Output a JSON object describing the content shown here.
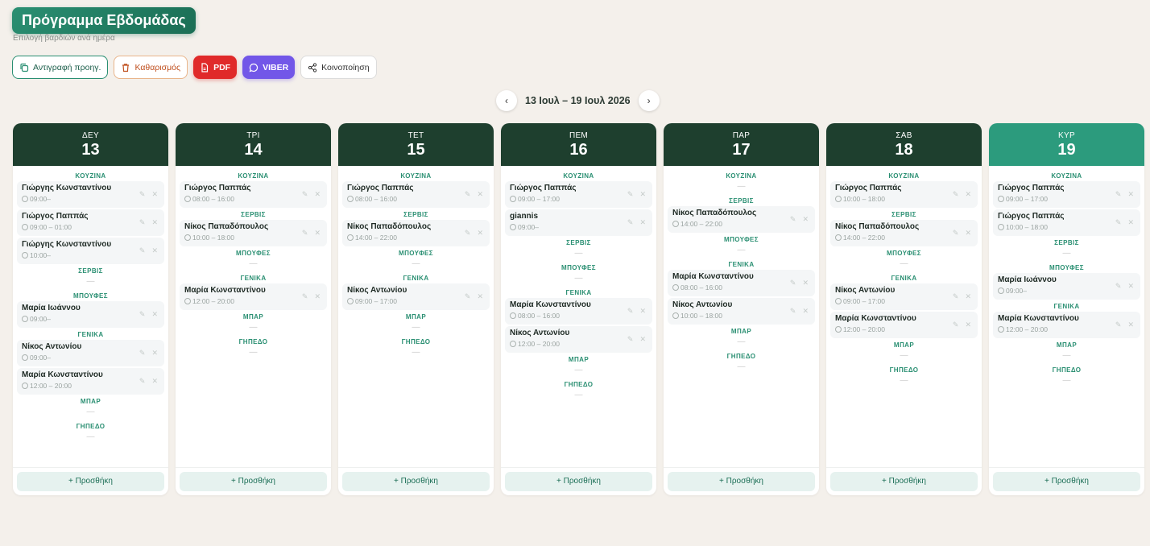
{
  "header": {
    "title": "Πρόγραμμα Εβδομάδας",
    "subtitle": "Επιλογή βαρδιών ανά ημέρα"
  },
  "toolbar": {
    "copy_label": "Αντιγραφή προηγ.",
    "clear_label": "Καθαρισμός",
    "pdf_label": "PDF",
    "viber_label": "VIBER",
    "share_label": "Κοινοποίηση"
  },
  "weeknav": {
    "prev_icon": "chevron-left-icon",
    "next_icon": "chevron-right-icon",
    "range": "13 Ιουλ – 19 Ιουλ 2026"
  },
  "add_label": "+ Προσθήκη",
  "empty_mark": "—",
  "colors": {
    "header": "#1e3f2e",
    "today_header": "#2c9b7d",
    "accent": "#2a8f72",
    "pdf": "#e02a2a",
    "viber": "#7257e8"
  },
  "days": [
    {
      "name": "ΔΕΥ",
      "num": "13",
      "today": false,
      "sections": [
        {
          "title": "ΚΟΥΖΙΝΑ",
          "shifts": [
            {
              "name": "Γιώργης Κωνσταντίνου",
              "time": "09:00–"
            },
            {
              "name": "Γιώργος Παππάς",
              "time": "09:00 – 01:00"
            },
            {
              "name": "Γιώργης Κωνσταντίνου",
              "time": "10:00–"
            }
          ]
        },
        {
          "title": "ΣΕΡΒΙΣ",
          "shifts": []
        },
        {
          "title": "ΜΠΟΥΦΕΣ",
          "shifts": [
            {
              "name": "Μαρία Ιωάννου",
              "time": "09:00–"
            }
          ]
        },
        {
          "title": "ΓΕΝΙΚΑ",
          "shifts": [
            {
              "name": "Νίκος Αντωνίου",
              "time": "09:00–"
            },
            {
              "name": "Μαρία Κωνσταντίνου",
              "time": "12:00 – 20:00"
            }
          ]
        },
        {
          "title": "ΜΠΑΡ",
          "shifts": []
        },
        {
          "title": "ΓΗΠΕΔΟ",
          "shifts": []
        }
      ]
    },
    {
      "name": "ΤΡΙ",
      "num": "14",
      "today": false,
      "sections": [
        {
          "title": "ΚΟΥΖΙΝΑ",
          "shifts": [
            {
              "name": "Γιώργος Παππάς",
              "time": "08:00 – 16:00"
            }
          ]
        },
        {
          "title": "ΣΕΡΒΙΣ",
          "shifts": [
            {
              "name": "Νίκος Παπαδόπουλος",
              "time": "10:00 – 18:00"
            }
          ]
        },
        {
          "title": "ΜΠΟΥΦΕΣ",
          "shifts": []
        },
        {
          "title": "ΓΕΝΙΚΑ",
          "shifts": [
            {
              "name": "Μαρία Κωνσταντίνου",
              "time": "12:00 – 20:00"
            }
          ]
        },
        {
          "title": "ΜΠΑΡ",
          "shifts": []
        },
        {
          "title": "ΓΗΠΕΔΟ",
          "shifts": []
        }
      ]
    },
    {
      "name": "ΤΕΤ",
      "num": "15",
      "today": false,
      "sections": [
        {
          "title": "ΚΟΥΖΙΝΑ",
          "shifts": [
            {
              "name": "Γιώργος Παππάς",
              "time": "08:00 – 16:00"
            }
          ]
        },
        {
          "title": "ΣΕΡΒΙΣ",
          "shifts": [
            {
              "name": "Νίκος Παπαδόπουλος",
              "time": "14:00 – 22:00"
            }
          ]
        },
        {
          "title": "ΜΠΟΥΦΕΣ",
          "shifts": []
        },
        {
          "title": "ΓΕΝΙΚΑ",
          "shifts": [
            {
              "name": "Νίκος Αντωνίου",
              "time": "09:00 – 17:00"
            }
          ]
        },
        {
          "title": "ΜΠΑΡ",
          "shifts": []
        },
        {
          "title": "ΓΗΠΕΔΟ",
          "shifts": []
        }
      ]
    },
    {
      "name": "ΠΕΜ",
      "num": "16",
      "today": false,
      "sections": [
        {
          "title": "ΚΟΥΖΙΝΑ",
          "shifts": [
            {
              "name": "Γιώργος Παππάς",
              "time": "09:00 – 17:00"
            },
            {
              "name": "giannis",
              "time": "09:00–"
            }
          ]
        },
        {
          "title": "ΣΕΡΒΙΣ",
          "shifts": []
        },
        {
          "title": "ΜΠΟΥΦΕΣ",
          "shifts": []
        },
        {
          "title": "ΓΕΝΙΚΑ",
          "shifts": [
            {
              "name": "Μαρία Κωνσταντίνου",
              "time": "08:00 – 16:00"
            },
            {
              "name": "Νίκος Αντωνίου",
              "time": "12:00 – 20:00"
            }
          ]
        },
        {
          "title": "ΜΠΑΡ",
          "shifts": []
        },
        {
          "title": "ΓΗΠΕΔΟ",
          "shifts": []
        }
      ]
    },
    {
      "name": "ΠΑΡ",
      "num": "17",
      "today": false,
      "sections": [
        {
          "title": "ΚΟΥΖΙΝΑ",
          "shifts": []
        },
        {
          "title": "ΣΕΡΒΙΣ",
          "shifts": [
            {
              "name": "Νίκος Παπαδόπουλος",
              "time": "14:00 – 22:00"
            }
          ]
        },
        {
          "title": "ΜΠΟΥΦΕΣ",
          "shifts": []
        },
        {
          "title": "ΓΕΝΙΚΑ",
          "shifts": [
            {
              "name": "Μαρία Κωνσταντίνου",
              "time": "08:00 – 16:00"
            },
            {
              "name": "Νίκος Αντωνίου",
              "time": "10:00 – 18:00"
            }
          ]
        },
        {
          "title": "ΜΠΑΡ",
          "shifts": []
        },
        {
          "title": "ΓΗΠΕΔΟ",
          "shifts": []
        }
      ]
    },
    {
      "name": "ΣΑΒ",
      "num": "18",
      "today": false,
      "sections": [
        {
          "title": "ΚΟΥΖΙΝΑ",
          "shifts": [
            {
              "name": "Γιώργος Παππάς",
              "time": "10:00 – 18:00"
            }
          ]
        },
        {
          "title": "ΣΕΡΒΙΣ",
          "shifts": [
            {
              "name": "Νίκος Παπαδόπουλος",
              "time": "14:00 – 22:00"
            }
          ]
        },
        {
          "title": "ΜΠΟΥΦΕΣ",
          "shifts": []
        },
        {
          "title": "ΓΕΝΙΚΑ",
          "shifts": [
            {
              "name": "Νίκος Αντωνίου",
              "time": "09:00 – 17:00"
            },
            {
              "name": "Μαρία Κωνσταντίνου",
              "time": "12:00 – 20:00"
            }
          ]
        },
        {
          "title": "ΜΠΑΡ",
          "shifts": []
        },
        {
          "title": "ΓΗΠΕΔΟ",
          "shifts": []
        }
      ]
    },
    {
      "name": "ΚΥΡ",
      "num": "19",
      "today": true,
      "sections": [
        {
          "title": "ΚΟΥΖΙΝΑ",
          "shifts": [
            {
              "name": "Γιώργος Παππάς",
              "time": "09:00 – 17:00"
            },
            {
              "name": "Γιώργος Παππάς",
              "time": "10:00 – 18:00"
            }
          ]
        },
        {
          "title": "ΣΕΡΒΙΣ",
          "shifts": []
        },
        {
          "title": "ΜΠΟΥΦΕΣ",
          "shifts": [
            {
              "name": "Μαρία Ιωάννου",
              "time": "09:00–"
            }
          ]
        },
        {
          "title": "ΓΕΝΙΚΑ",
          "shifts": [
            {
              "name": "Μαρία Κωνσταντίνου",
              "time": "12:00 – 20:00"
            }
          ]
        },
        {
          "title": "ΜΠΑΡ",
          "shifts": []
        },
        {
          "title": "ΓΗΠΕΔΟ",
          "shifts": []
        }
      ]
    }
  ]
}
